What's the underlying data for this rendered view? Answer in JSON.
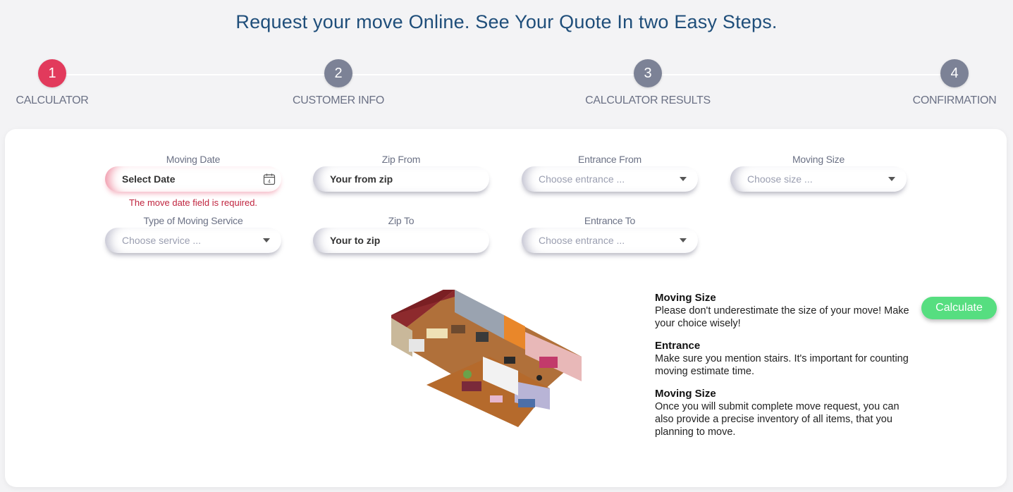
{
  "page": {
    "title": "Request your move Online. See Your Quote In two Easy Steps."
  },
  "steps": [
    {
      "number": "1",
      "label": "CALCULATOR",
      "active": true
    },
    {
      "number": "2",
      "label": "CUSTOMER INFO",
      "active": false
    },
    {
      "number": "3",
      "label": "CALCULATOR RESULTS",
      "active": false
    },
    {
      "number": "4",
      "label": "CONFIRMATION",
      "active": false
    }
  ],
  "form": {
    "moving_date": {
      "label": "Moving Date",
      "value": "Select Date",
      "error": "The move date field is required.",
      "calendar_day": "4"
    },
    "zip_from": {
      "label": "Zip From",
      "value": "Your from zip"
    },
    "entrance_from": {
      "label": "Entrance From",
      "placeholder": "Choose entrance ..."
    },
    "moving_size": {
      "label": "Moving Size",
      "placeholder": "Choose size ..."
    },
    "service_type": {
      "label": "Type of Moving Service",
      "placeholder": "Choose service ..."
    },
    "zip_to": {
      "label": "Zip To",
      "value": "Your to zip"
    },
    "entrance_to": {
      "label": "Entrance To",
      "placeholder": "Choose entrance ..."
    }
  },
  "info": [
    {
      "title": "Moving Size",
      "text": "Please don't underestimate the size of your move! Make your choice wisely!"
    },
    {
      "title": "Entrance",
      "text": "Make sure you mention stairs. It's important for counting moving estimate time."
    },
    {
      "title": "Moving Size",
      "text": "Once you will submit complete move request, you can also provide a precise inventory of all items, that you planning to move."
    }
  ],
  "actions": {
    "calculate_label": "Calculate"
  },
  "colors": {
    "accent_active": "#e23a5c",
    "step_inactive": "#7c8296",
    "title": "#1f4e7a",
    "calculate": "#56de80",
    "error": "#c0253f"
  }
}
